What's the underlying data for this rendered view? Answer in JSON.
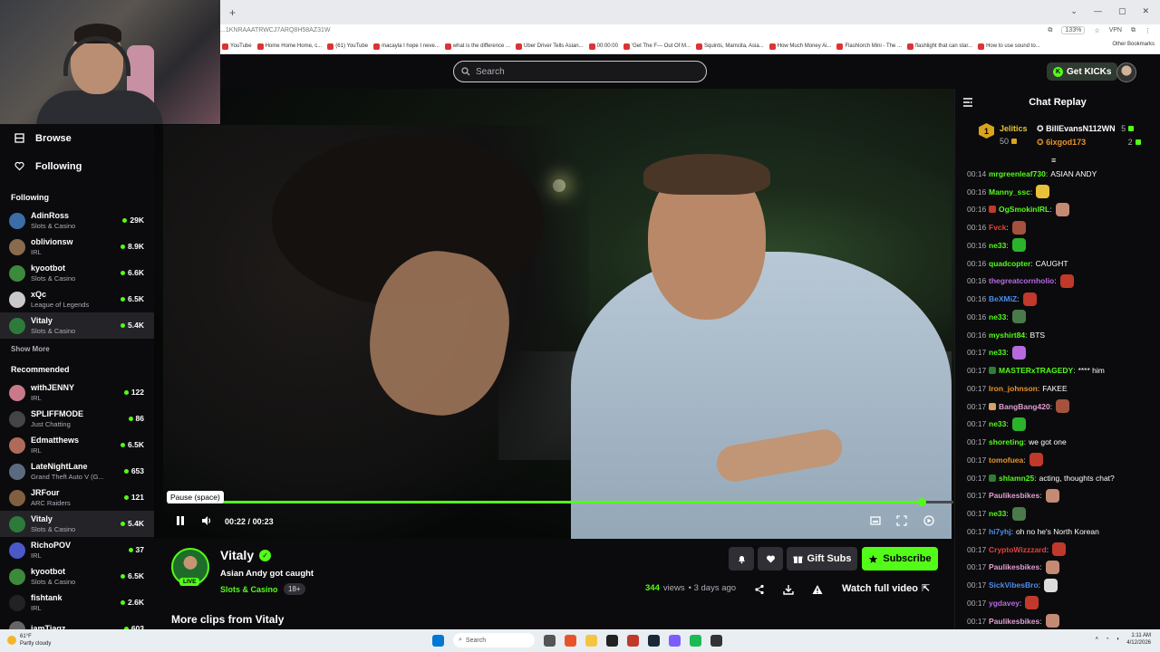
{
  "browser": {
    "url": "...1KNRAAATRWCJ7ARQ8H58AZ31W",
    "zoom": "133%",
    "vpn": "VPN",
    "bookmarks": [
      "YouTube",
      "Home Home Home, c...",
      "(61) YouTube",
      "macayla I hope I neve...",
      "what is the difference ...",
      "Uber Driver Tells Asian...",
      "00:00:00",
      "'Get The F--- Out Of M...",
      "Squints, Mamcita, Asia...",
      "How Much Money Ai...",
      "Flashlorch Mini - The ...",
      "flashlight that can star...",
      "How to use sound to..."
    ],
    "other_bookmarks": "Other Bookmarks"
  },
  "topnav": {
    "search_placeholder": "Search",
    "get_kicks": "Get KICKs"
  },
  "sidebar": {
    "nav": [
      {
        "label": "Browse",
        "icon": "browse-icon"
      },
      {
        "label": "Following",
        "icon": "heart-icon"
      }
    ],
    "following_title": "Following",
    "following": [
      {
        "name": "AdinRoss",
        "category": "Slots & Casino",
        "viewers": "29K",
        "color": "#3b6ea8"
      },
      {
        "name": "oblivionsw",
        "category": "IRL",
        "viewers": "8.9K",
        "color": "#8a6a4c"
      },
      {
        "name": "kyootbot",
        "category": "Slots & Casino",
        "viewers": "6.6K",
        "color": "#3d8a3a"
      },
      {
        "name": "xQc",
        "category": "League of Legends",
        "viewers": "6.5K",
        "color": "#c9c9c9"
      },
      {
        "name": "Vitaly",
        "category": "Slots & Casino",
        "viewers": "5.4K",
        "color": "#2d7a3a"
      }
    ],
    "show_more": "Show More",
    "recommended_title": "Recommended",
    "recommended": [
      {
        "name": "withJENNY",
        "category": "IRL",
        "viewers": "122",
        "color": "#c87a8a"
      },
      {
        "name": "SPLIFFMODE",
        "category": "Just Chatting",
        "viewers": "86",
        "color": "#444"
      },
      {
        "name": "Edmatthews",
        "category": "IRL",
        "viewers": "6.5K",
        "color": "#b06a5a"
      },
      {
        "name": "LateNightLane",
        "category": "Grand Theft Auto V (G...",
        "viewers": "653",
        "color": "#5a6b80"
      },
      {
        "name": "JRFour",
        "category": "ARC Raiders",
        "viewers": "121",
        "color": "#806040"
      },
      {
        "name": "Vitaly",
        "category": "Slots & Casino",
        "viewers": "5.4K",
        "color": "#2d7a3a"
      },
      {
        "name": "RichoPOV",
        "category": "IRL",
        "viewers": "37",
        "color": "#4a58c8"
      },
      {
        "name": "kyootbot",
        "category": "Slots & Casino",
        "viewers": "6.5K",
        "color": "#3d8a3a"
      },
      {
        "name": "fishtank",
        "category": "IRL",
        "viewers": "2.6K",
        "color": "#222"
      },
      {
        "name": "jamTiagz",
        "category": "",
        "viewers": "603",
        "color": "#666"
      }
    ]
  },
  "player": {
    "tooltip": "Pause (space)",
    "current_time": "00:22",
    "separator": "/",
    "duration": "00:23",
    "progress_fraction": 0.96
  },
  "clip": {
    "streamer": "Vitaly",
    "live_badge": "LIVE",
    "title": "Asian Andy got caught",
    "category": "Slots & Casino",
    "age_rating": "18+",
    "views_count": "344",
    "views_label": "views",
    "posted": "• 3 days ago",
    "gift_subs": "Gift Subs",
    "subscribe": "Subscribe",
    "watch_full": "Watch full video",
    "more_clips": "More clips from Vitaly"
  },
  "chat": {
    "title": "Chat Replay",
    "leaderboard": {
      "rank": "1",
      "first": {
        "name": "Jelitics",
        "count": "50"
      },
      "second": {
        "name": "BillEvansN112WN",
        "count": "5"
      },
      "third": {
        "name": "6ixgod173",
        "count": "2"
      }
    },
    "messages": [
      {
        "time": "00:14",
        "user": "mrgreenleaf730",
        "text": "ASIAN ANDY",
        "color": "#53fc18",
        "emote": ""
      },
      {
        "time": "00:16",
        "user": "Manny_ssc",
        "text": "",
        "color": "#53fc18",
        "emote": "#e8c13a"
      },
      {
        "time": "00:16",
        "user": "OgSmokinIRL",
        "text": "",
        "color": "#53fc18",
        "emote": "#c58a74",
        "badge": "#c0392b"
      },
      {
        "time": "00:16",
        "user": "Fvck",
        "text": "",
        "color": "#e0433c",
        "emote": "#a4523e"
      },
      {
        "time": "00:16",
        "user": "ne33",
        "text": "",
        "color": "#53fc18",
        "emote": "#2bb32b"
      },
      {
        "time": "00:16",
        "user": "quadcopter",
        "text": "CAUGHT",
        "color": "#53fc18",
        "emote": ""
      },
      {
        "time": "00:16",
        "user": "thegreatcornholio",
        "text": "",
        "color": "#b66ae0",
        "emote": "#c0392b"
      },
      {
        "time": "00:16",
        "user": "BeXMiZ",
        "text": "",
        "color": "#4a8df0",
        "emote": "#c0392b"
      },
      {
        "time": "00:16",
        "user": "ne33",
        "text": "",
        "color": "#53fc18",
        "emote": "#4a7a4a"
      },
      {
        "time": "00:16",
        "user": "myshirt84",
        "text": "BTS",
        "color": "#53fc18",
        "emote": ""
      },
      {
        "time": "00:17",
        "user": "ne33",
        "text": "",
        "color": "#53fc18",
        "emote": "#b66ae0"
      },
      {
        "time": "00:17",
        "user": "MASTERxTRAGEDY",
        "text": "**** him",
        "color": "#53fc18",
        "emote": "",
        "badge": "#2e7d32"
      },
      {
        "time": "00:17",
        "user": "Iron_johnson",
        "text": "FAKEE",
        "color": "#e8932a",
        "emote": ""
      },
      {
        "time": "00:17",
        "user": "BangBang420",
        "text": "",
        "color": "#e39fd0",
        "emote": "#a4523e",
        "badge": "#d7a06a"
      },
      {
        "time": "00:17",
        "user": "ne33",
        "text": "",
        "color": "#53fc18",
        "emote": "#2bb32b"
      },
      {
        "time": "00:17",
        "user": "shoreting",
        "text": "we got one",
        "color": "#53fc18",
        "emote": ""
      },
      {
        "time": "00:17",
        "user": "tomofuea",
        "text": "",
        "color": "#e8932a",
        "emote": "#c0392b"
      },
      {
        "time": "00:17",
        "user": "shlamn25",
        "text": "acting, thoughts chat?",
        "color": "#53fc18",
        "emote": "",
        "badge": "#2e7d32"
      },
      {
        "time": "00:17",
        "user": "Paulikesbikes",
        "text": "",
        "color": "#e39fd0",
        "emote": "#c58a74"
      },
      {
        "time": "00:17",
        "user": "ne33",
        "text": "",
        "color": "#53fc18",
        "emote": "#4a7a4a"
      },
      {
        "time": "00:17",
        "user": "hi7yhj",
        "text": "oh no he's North Korean",
        "color": "#4a8df0",
        "emote": ""
      },
      {
        "time": "00:17",
        "user": "CryptoWizzzard",
        "text": "",
        "color": "#e0433c",
        "emote": "#c0392b"
      },
      {
        "time": "00:17",
        "user": "Paulikesbikes",
        "text": "",
        "color": "#e39fd0",
        "emote": "#c58a74"
      },
      {
        "time": "00:17",
        "user": "SickVibesBro",
        "text": "",
        "color": "#4a8df0",
        "emote": "#ddd"
      },
      {
        "time": "00:17",
        "user": "ygdavey",
        "text": "",
        "color": "#b66ae0",
        "emote": "#c0392b"
      },
      {
        "time": "00:17",
        "user": "Paulikesbikes",
        "text": "",
        "color": "#e39fd0",
        "emote": "#c58a74"
      }
    ]
  },
  "taskbar": {
    "weather_temp": "61°F",
    "weather_desc": "Partly cloudy",
    "search": "Search",
    "time": "1:11 AM",
    "date": "4/12/2026"
  },
  "colors": {
    "accent": "#53fc18",
    "background": "#0b0b0d",
    "panel": "#2f2f35"
  }
}
